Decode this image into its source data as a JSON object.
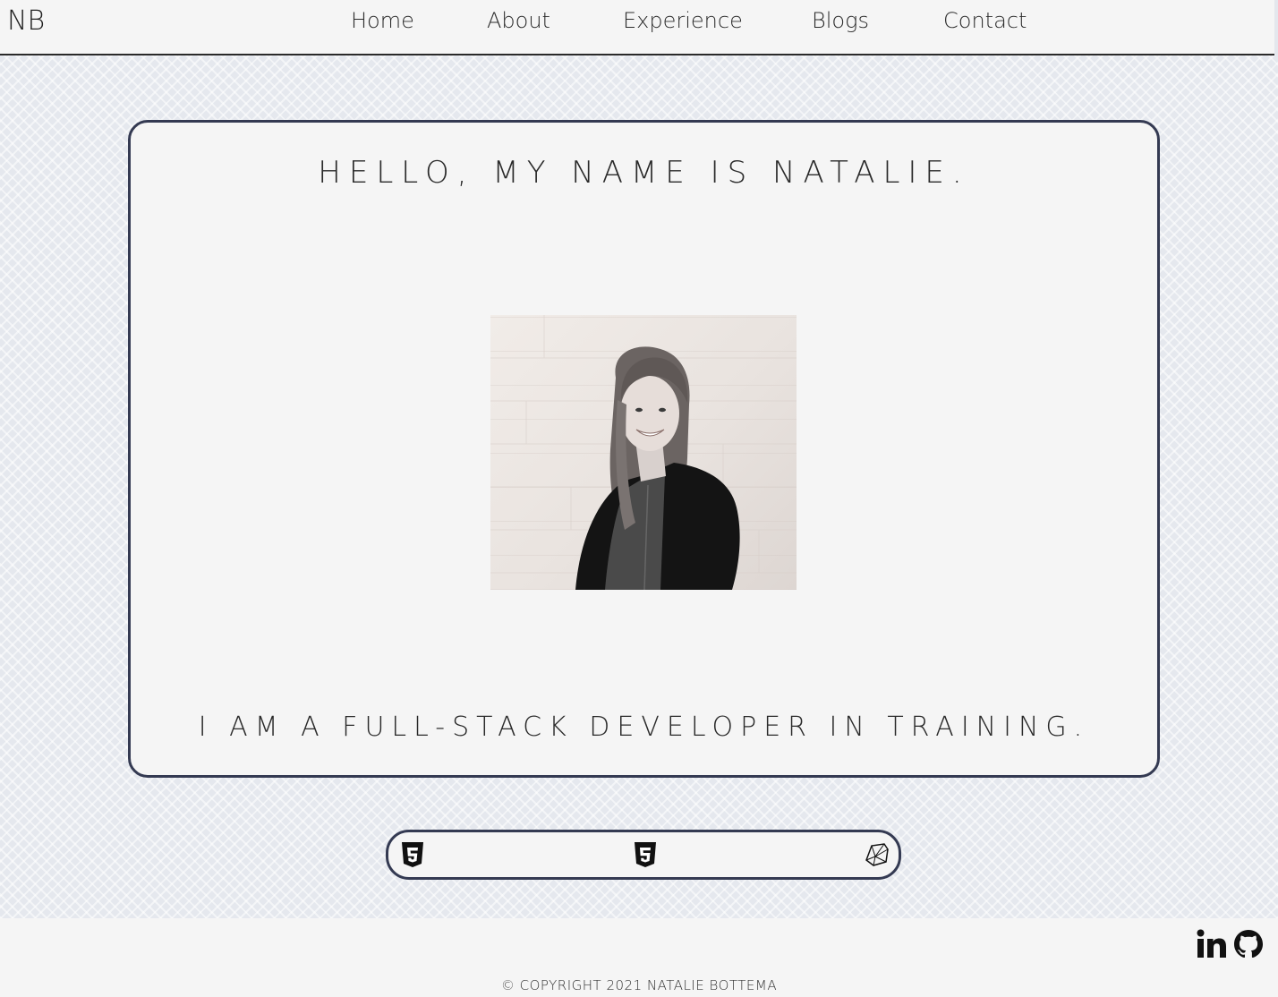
{
  "header": {
    "logo": "NB",
    "nav": [
      {
        "label": "Home"
      },
      {
        "label": "About"
      },
      {
        "label": "Experience"
      },
      {
        "label": "Blogs"
      },
      {
        "label": "Contact"
      }
    ]
  },
  "hero": {
    "title": "HELLO, MY NAME IS NATALIE.",
    "subtitle": "I AM A FULL-STACK DEVELOPER IN TRAINING."
  },
  "skills": {
    "icons": [
      "html5-icon",
      "css3-icon",
      "ruby-icon"
    ]
  },
  "footer": {
    "copyright": "© COPYRIGHT 2021 NATALIE BOTTEMA",
    "social_icons": [
      "linkedin-icon",
      "github-icon"
    ]
  },
  "colors": {
    "border": "#343a52",
    "surface": "#f5f5f5",
    "background": "#e5e8ee"
  }
}
